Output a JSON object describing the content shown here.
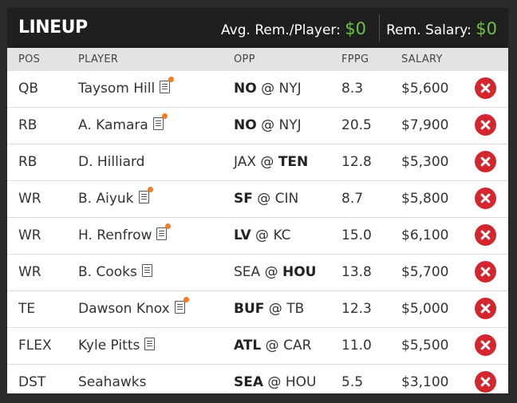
{
  "header": {
    "title": "LINEUP",
    "avg_label": "Avg. Rem./Player:",
    "avg_value": "$0",
    "rem_label": "Rem. Salary:",
    "rem_value": "$0"
  },
  "columns": {
    "pos": "POS",
    "player": "PLAYER",
    "opp": "OPP",
    "fppg": "FPPG",
    "salary": "SALARY"
  },
  "rows": [
    {
      "pos": "QB",
      "player": "Taysom Hill",
      "news": true,
      "alert": true,
      "away": "NO",
      "home": "NYJ",
      "bold": "away",
      "fppg": "8.3",
      "salary": "$5,600"
    },
    {
      "pos": "RB",
      "player": "A. Kamara",
      "news": true,
      "alert": true,
      "away": "NO",
      "home": "NYJ",
      "bold": "away",
      "fppg": "20.5",
      "salary": "$7,900"
    },
    {
      "pos": "RB",
      "player": "D. Hilliard",
      "news": false,
      "alert": false,
      "away": "JAX",
      "home": "TEN",
      "bold": "home",
      "fppg": "12.8",
      "salary": "$5,300"
    },
    {
      "pos": "WR",
      "player": "B. Aiyuk",
      "news": true,
      "alert": true,
      "away": "SF",
      "home": "CIN",
      "bold": "away",
      "fppg": "8.7",
      "salary": "$5,800"
    },
    {
      "pos": "WR",
      "player": "H. Renfrow",
      "news": true,
      "alert": true,
      "away": "LV",
      "home": "KC",
      "bold": "away",
      "fppg": "15.0",
      "salary": "$6,100"
    },
    {
      "pos": "WR",
      "player": "B. Cooks",
      "news": true,
      "alert": false,
      "away": "SEA",
      "home": "HOU",
      "bold": "home",
      "fppg": "13.8",
      "salary": "$5,700"
    },
    {
      "pos": "TE",
      "player": "Dawson Knox",
      "news": true,
      "alert": true,
      "away": "BUF",
      "home": "TB",
      "bold": "away",
      "fppg": "12.3",
      "salary": "$5,000"
    },
    {
      "pos": "FLEX",
      "player": "Kyle Pitts",
      "news": true,
      "alert": false,
      "away": "ATL",
      "home": "CAR",
      "bold": "away",
      "fppg": "11.0",
      "salary": "$5,500"
    },
    {
      "pos": "DST",
      "player": "Seahawks",
      "news": false,
      "alert": false,
      "away": "SEA",
      "home": "HOU",
      "bold": "away",
      "fppg": "5.5",
      "salary": "$3,100"
    }
  ],
  "colors": {
    "accent_green": "#6cc24a",
    "remove_red": "#d4262f",
    "news_alert": "#f47b20"
  }
}
